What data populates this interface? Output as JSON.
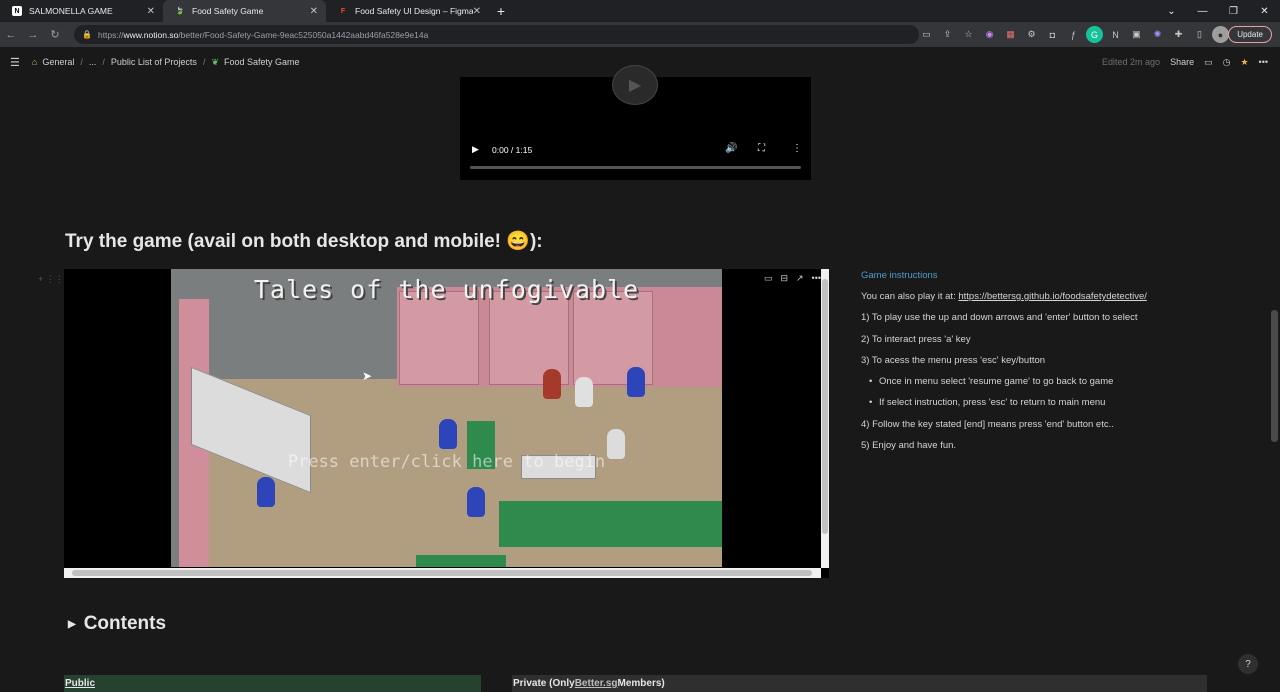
{
  "browser": {
    "tabs": [
      {
        "title": "SALMONELLA GAME",
        "favicon": "N",
        "favicon_color": "#ffffff"
      },
      {
        "title": "Food Safety Game",
        "favicon": "🍃",
        "favicon_color": "#4caf50"
      },
      {
        "title": "Food Safety UI Design – Figma",
        "favicon": "F",
        "favicon_color": "#f24e1e"
      }
    ],
    "url_prefix": "https://",
    "url_host": "www.notion.so",
    "url_path": "/better/Food-Safety-Game-9eac525050a1442aabd46fa528e9e14a",
    "update_label": "Update"
  },
  "notion": {
    "breadcrumb": [
      "General",
      "...",
      "Public List of Projects",
      "Food Safety Game"
    ],
    "edited": "Edited 2m ago",
    "share": "Share"
  },
  "video": {
    "time": "0:00 / 1:15"
  },
  "section_heading": "Try the game (avail on both desktop and mobile! 😄):",
  "game": {
    "title": "Tales of the unfogivable",
    "prompt": "Press enter/click here to begin"
  },
  "instructions": {
    "title": "Game instructions",
    "line0_prefix": "You can also play it at: ",
    "line0_link": "https://bettersg.github.io/foodsafetydetective/",
    "line1": "1) To play use the up and down arrows and 'enter' button to select",
    "line2": "2) To interact press 'a' key",
    "line3": "3) To acess the menu press 'esc' key/button",
    "bullet1": "Once in menu select 'resume game' to go back to game",
    "bullet2": "If select instruction, press 'esc' to return to main menu",
    "line4": "4) Follow the key stated [end] means press 'end' button etc..",
    "line5": "5) Enjoy and have fun."
  },
  "contents_label": "Contents",
  "public_label": "Public",
  "private_prefix": "Private (Only ",
  "private_link": "Better.sg",
  "private_suffix": " Members)",
  "help_label": "?"
}
